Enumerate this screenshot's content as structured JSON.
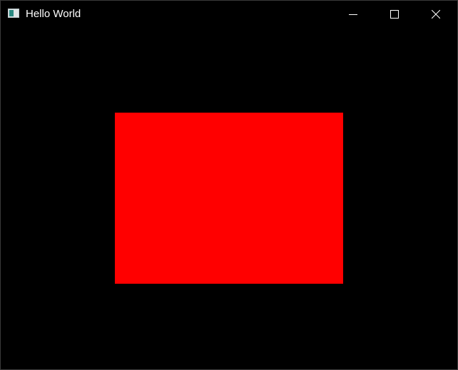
{
  "window": {
    "title": "Hello World",
    "app_icon": "window-app-icon",
    "controls": {
      "minimize_icon": "minimize-icon",
      "maximize_icon": "maximize-icon",
      "close_icon": "close-icon"
    },
    "background_color": "#000000"
  },
  "canvas": {
    "background_color": "#000000",
    "shape_color": "#ff0000"
  }
}
